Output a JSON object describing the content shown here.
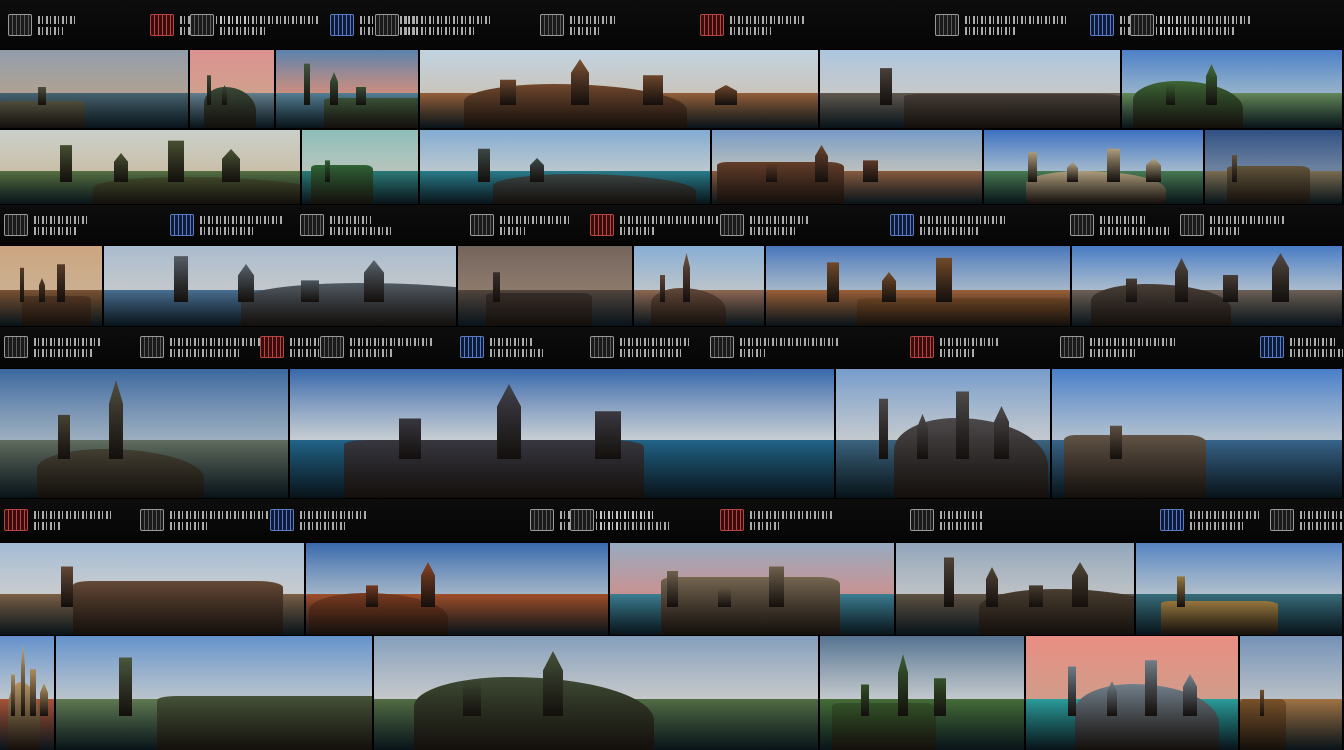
{
  "page": {
    "background": "#070707"
  },
  "label_strip": {
    "text_color": "#cfcfcf",
    "icon": "pictogram-icon"
  },
  "tiles": [
    {
      "name": "lighthouse-shore",
      "icon": "lighthouse-icon",
      "sky": [
        "#8a97a6",
        "#c9b9a8"
      ],
      "water": "#4d6f7e",
      "land": "#5b5a44"
    },
    {
      "name": "pink-sunset-sea",
      "icon": "sunset-icon",
      "sky": [
        "#d98a8a",
        "#f0b7a0"
      ],
      "water": "#6e8fa0",
      "land": "#394b37"
    },
    {
      "name": "palm-island-dusk",
      "icon": "palm-tree-icon",
      "sky": [
        "#4f7aa8",
        "#e9a18f"
      ],
      "water": "#5b8ea7",
      "land": "#3e5a3a"
    },
    {
      "name": "moorish-courtyard",
      "icon": "arch-icon",
      "sky": [
        "#bcd0df",
        "#e9e3d9"
      ],
      "water": "#a86a3c",
      "land": "#7a4a2a"
    },
    {
      "name": "cathedral-city",
      "icon": "cathedral-icon",
      "sky": [
        "#a6c2dd",
        "#e5e8ea"
      ],
      "water": "#6b6156",
      "land": "#4a4038"
    },
    {
      "name": "green-park-coast",
      "icon": "park-icon",
      "sky": [
        "#3f77c4",
        "#a9cdea"
      ],
      "water": "#6f9a62",
      "land": "#3c6a34"
    },
    {
      "name": "highland-valley",
      "icon": "hill-icon",
      "sky": [
        "#c5ccc6",
        "#e9ddc4"
      ],
      "water": "#5e7d46",
      "land": "#46502c"
    },
    {
      "name": "green-islet",
      "icon": "island-icon",
      "sky": [
        "#85b8b4",
        "#d2e4d9"
      ],
      "water": "#2d8a86",
      "land": "#2e6b38"
    },
    {
      "name": "rock-island-lagoon",
      "icon": "island-icon",
      "sky": [
        "#7aa6cf",
        "#d6e6ef"
      ],
      "water": "#2a8c9e",
      "land": "#3d4a48"
    },
    {
      "name": "palace-terrace",
      "icon": "palace-icon",
      "sky": [
        "#6c94c3",
        "#d8dcd9"
      ],
      "water": "#9a6444",
      "land": "#6a3d26"
    },
    {
      "name": "sandy-bay",
      "icon": "beach-icon",
      "sky": [
        "#2f67bd",
        "#b9d4ec"
      ],
      "water": "#4e8a5a",
      "land": "#c9b58e"
    },
    {
      "name": "stone-monument",
      "icon": "monument-icon",
      "sky": [
        "#23457c",
        "#7c95b7"
      ],
      "water": "#8c7a5a",
      "land": "#6b5a3c"
    },
    {
      "name": "carved-statue",
      "icon": "statue-icon",
      "sky": [
        "#c99f78",
        "#e9c9a3"
      ],
      "water": "#8a5a34",
      "land": "#5a3a22"
    },
    {
      "name": "skyline-harbor",
      "icon": "skyline-icon",
      "sky": [
        "#a4b7cc",
        "#e0e6ea"
      ],
      "water": "#4e7ba3",
      "land": "#55606a"
    },
    {
      "name": "ruins-closeup",
      "icon": "ruins-icon",
      "sky": [
        "#6a5a50",
        "#a08a7a"
      ],
      "water": "#5a4a40",
      "land": "#3a2e28"
    },
    {
      "name": "old-town",
      "icon": "town-icon",
      "sky": [
        "#7fa8d2",
        "#d7e2ea"
      ],
      "water": "#a0735a",
      "land": "#6d4c3a"
    },
    {
      "name": "desert-fort",
      "icon": "fort-icon",
      "sky": [
        "#3c6db6",
        "#bcd3e8"
      ],
      "water": "#b06a3a",
      "land": "#7a4a24"
    },
    {
      "name": "coastal-city-panorama",
      "icon": "city-icon",
      "sky": [
        "#3b73c0",
        "#c3d8ee"
      ],
      "water": "#7a6a5e",
      "land": "#4c4038"
    },
    {
      "name": "shore-ruins",
      "icon": "ruins-icon",
      "sky": [
        "#2f5e99",
        "#b4c9dd"
      ],
      "water": "#6c7a6a",
      "land": "#4a4636"
    },
    {
      "name": "gothic-sea-spires",
      "icon": "spire-icon",
      "sky": [
        "#2a5ea6",
        "#e6eef4"
      ],
      "water": "#1f6f9b",
      "land": "#3a3a44"
    },
    {
      "name": "spire-rocks",
      "icon": "spire-icon",
      "sky": [
        "#6d96c8",
        "#e2e8ee"
      ],
      "water": "#3f6f8f",
      "land": "#4e4a4c"
    },
    {
      "name": "seaside-towers",
      "icon": "tower-icon",
      "sky": [
        "#3d76c6",
        "#cfe0ef"
      ],
      "water": "#3a6f9c",
      "land": "#6a5a4a"
    },
    {
      "name": "grand-cathedral",
      "icon": "cathedral-icon",
      "sky": [
        "#9db7d3",
        "#e7ebee"
      ],
      "water": "#8a6a4c",
      "land": "#6a4a34"
    },
    {
      "name": "red-canyon",
      "icon": "canyon-icon",
      "sky": [
        "#2c5fa8",
        "#b7cfe6"
      ],
      "water": "#b8562a",
      "land": "#8a3e1e"
    },
    {
      "name": "harbor-towers",
      "icon": "harbor-icon",
      "sky": [
        "#8fa6bd",
        "#e6a7a7"
      ],
      "water": "#3f8fa6",
      "land": "#7c6a52"
    },
    {
      "name": "temple-colonnade",
      "icon": "temple-icon",
      "sky": [
        "#8aa0b6",
        "#d9dfe4"
      ],
      "water": "#6a5a48",
      "land": "#4e4030"
    },
    {
      "name": "golden-pagoda",
      "icon": "pagoda-icon",
      "sky": [
        "#4a7cbf",
        "#c9dbeb"
      ],
      "water": "#3a7a8a",
      "land": "#b08a44"
    },
    {
      "name": "red-museum-coast",
      "icon": "museum-icon",
      "sky": [
        "#5a8ac8",
        "#dbe6ef"
      ],
      "water": "#c05a3a",
      "land": "#c9a26a"
    },
    {
      "name": "palm-courtyard",
      "icon": "palm-tree-icon",
      "sky": [
        "#5a8cc9",
        "#d6e2ec"
      ],
      "water": "#6a8a5a",
      "land": "#4a5a3a"
    },
    {
      "name": "monument-field",
      "icon": "monument-icon",
      "sky": [
        "#7b98b8",
        "#e4e7e9"
      ],
      "water": "#5a7a4a",
      "land": "#3c4a30"
    },
    {
      "name": "green-hill",
      "icon": "hill-icon",
      "sky": [
        "#4a6a8a",
        "#dfe6ec"
      ],
      "water": "#4a7a3a",
      "land": "#355a28"
    },
    {
      "name": "turquoise-resort",
      "icon": "resort-icon",
      "sky": [
        "#e8867a",
        "#f1b29c"
      ],
      "water": "#2ab3b0",
      "land": "#7a8a96"
    },
    {
      "name": "sand-sculpture",
      "icon": "sculpture-icon",
      "sky": [
        "#6a8ab2",
        "#d3dce5"
      ],
      "water": "#b8824a",
      "land": "#8a5a2a"
    }
  ]
}
